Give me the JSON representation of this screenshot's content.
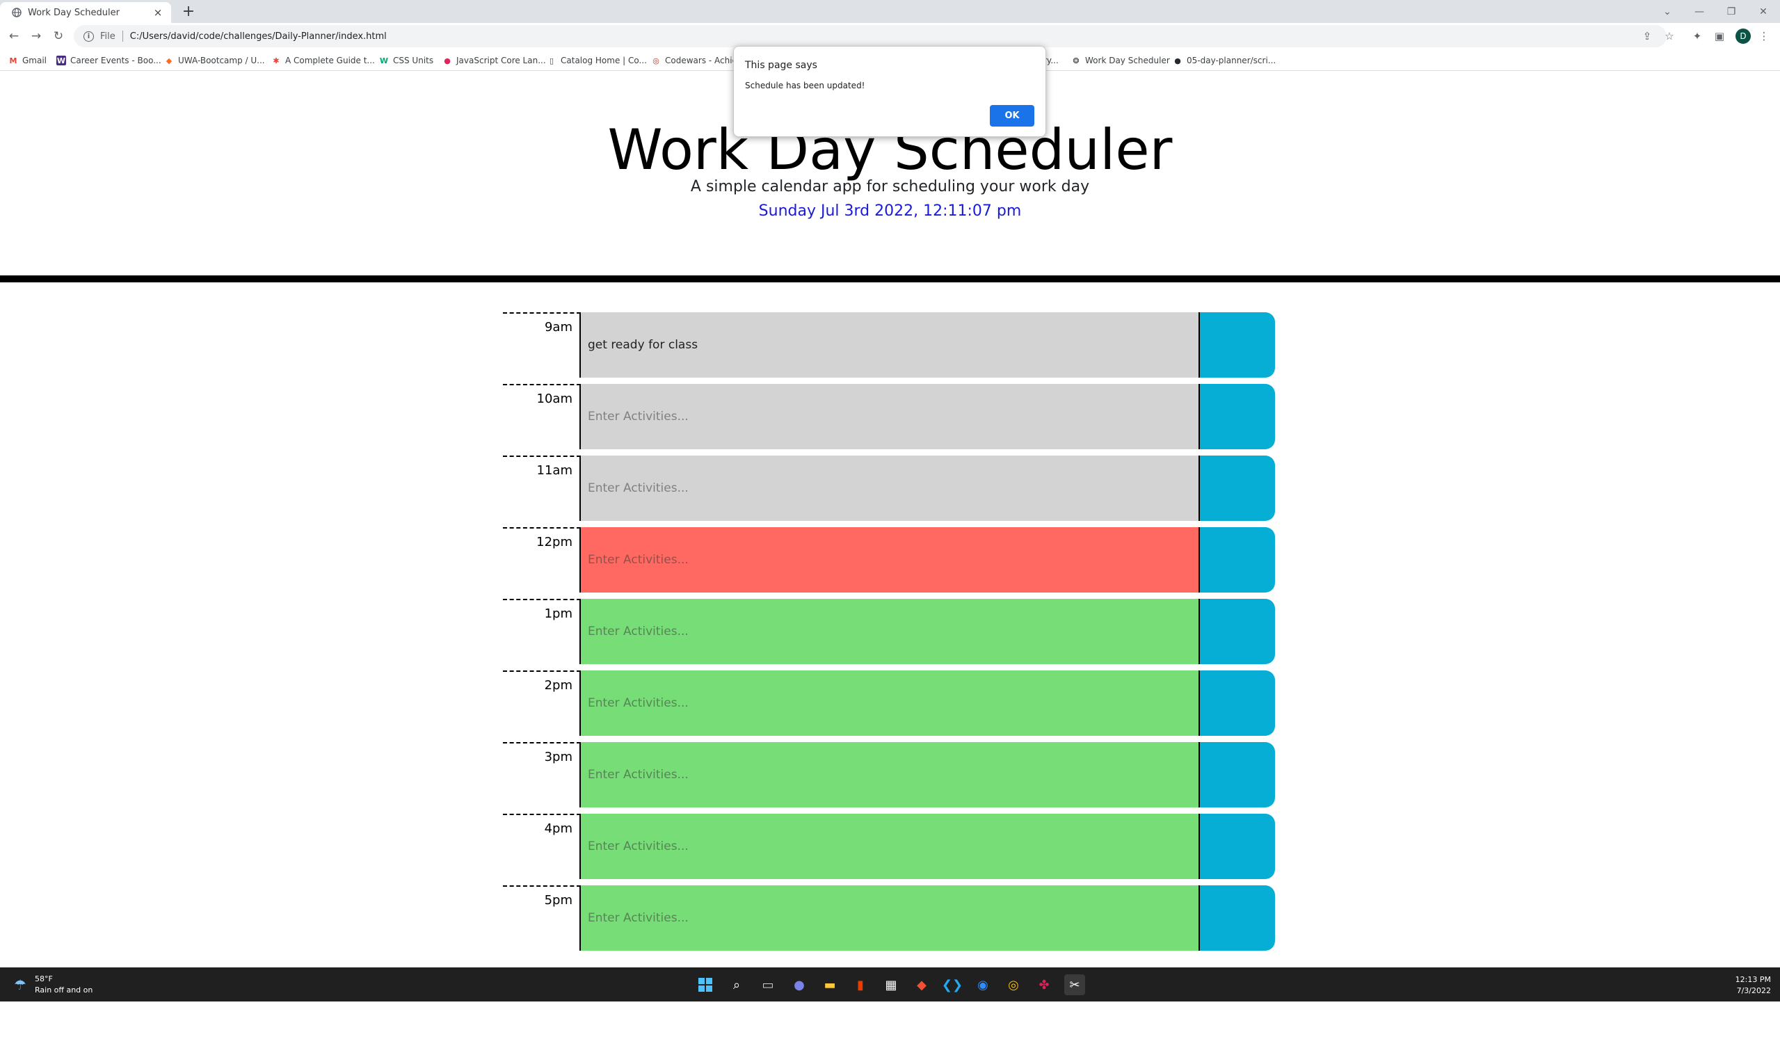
{
  "browser": {
    "tab_title": "Work Day Scheduler",
    "new_tab": "+",
    "tab_close": "×",
    "url_scheme": "File",
    "url": "C:/Users/david/code/challenges/Daily-Planner/index.html",
    "profile_initial": "D",
    "bookmarks": [
      {
        "label": "Gmail",
        "icon": "M",
        "color": "#ea4335"
      },
      {
        "label": "Career Events - Boo...",
        "icon": "W",
        "color": "#4b2e83"
      },
      {
        "label": "UWA-Bootcamp / U...",
        "icon": "◆",
        "color": "#fc6d26"
      },
      {
        "label": "A Complete Guide t...",
        "icon": "✱",
        "color": "#e8453c"
      },
      {
        "label": "CSS Units",
        "icon": "W",
        "color": "#04aa6d"
      },
      {
        "label": "JavaScript Core Lan...",
        "icon": "●",
        "color": "#e0245e"
      },
      {
        "label": "Catalog Home | Co...",
        "icon": "▯",
        "color": "#444444"
      },
      {
        "label": "Codewars - Achie",
        "icon": "◎",
        "color": "#b1361e"
      },
      {
        "label": "ry...",
        "icon": "",
        "color": "#444444"
      },
      {
        "label": "Work Day Scheduler",
        "icon": "❂",
        "color": "#333333"
      },
      {
        "label": "05-day-planner/scri...",
        "icon": "●",
        "color": "#24292f"
      }
    ]
  },
  "header": {
    "title": "Work Day Scheduler",
    "lead": "A simple calendar app for scheduling your work day",
    "current_day": "Sunday Jul 3rd 2022, 12:11:07 pm"
  },
  "schedule": {
    "placeholder": "Enter Activities...",
    "colors": {
      "past": "#d3d3d3",
      "present": "#ff6961",
      "future": "#77dd77",
      "save": "#06aed5"
    },
    "rows": [
      {
        "hour": "9am",
        "state": "past",
        "text": "get ready for class"
      },
      {
        "hour": "10am",
        "state": "past",
        "text": ""
      },
      {
        "hour": "11am",
        "state": "past",
        "text": ""
      },
      {
        "hour": "12pm",
        "state": "present",
        "text": ""
      },
      {
        "hour": "1pm",
        "state": "future",
        "text": ""
      },
      {
        "hour": "2pm",
        "state": "future",
        "text": ""
      },
      {
        "hour": "3pm",
        "state": "future",
        "text": ""
      },
      {
        "hour": "4pm",
        "state": "future",
        "text": ""
      },
      {
        "hour": "5pm",
        "state": "future",
        "text": ""
      }
    ]
  },
  "dialog": {
    "title": "This page says",
    "message": "Schedule has been updated!",
    "ok_label": "OK"
  },
  "taskbar": {
    "weather_temp": "58°F",
    "weather_desc": "Rain off and on",
    "time": "12:13 PM",
    "date": "7/3/2022"
  }
}
